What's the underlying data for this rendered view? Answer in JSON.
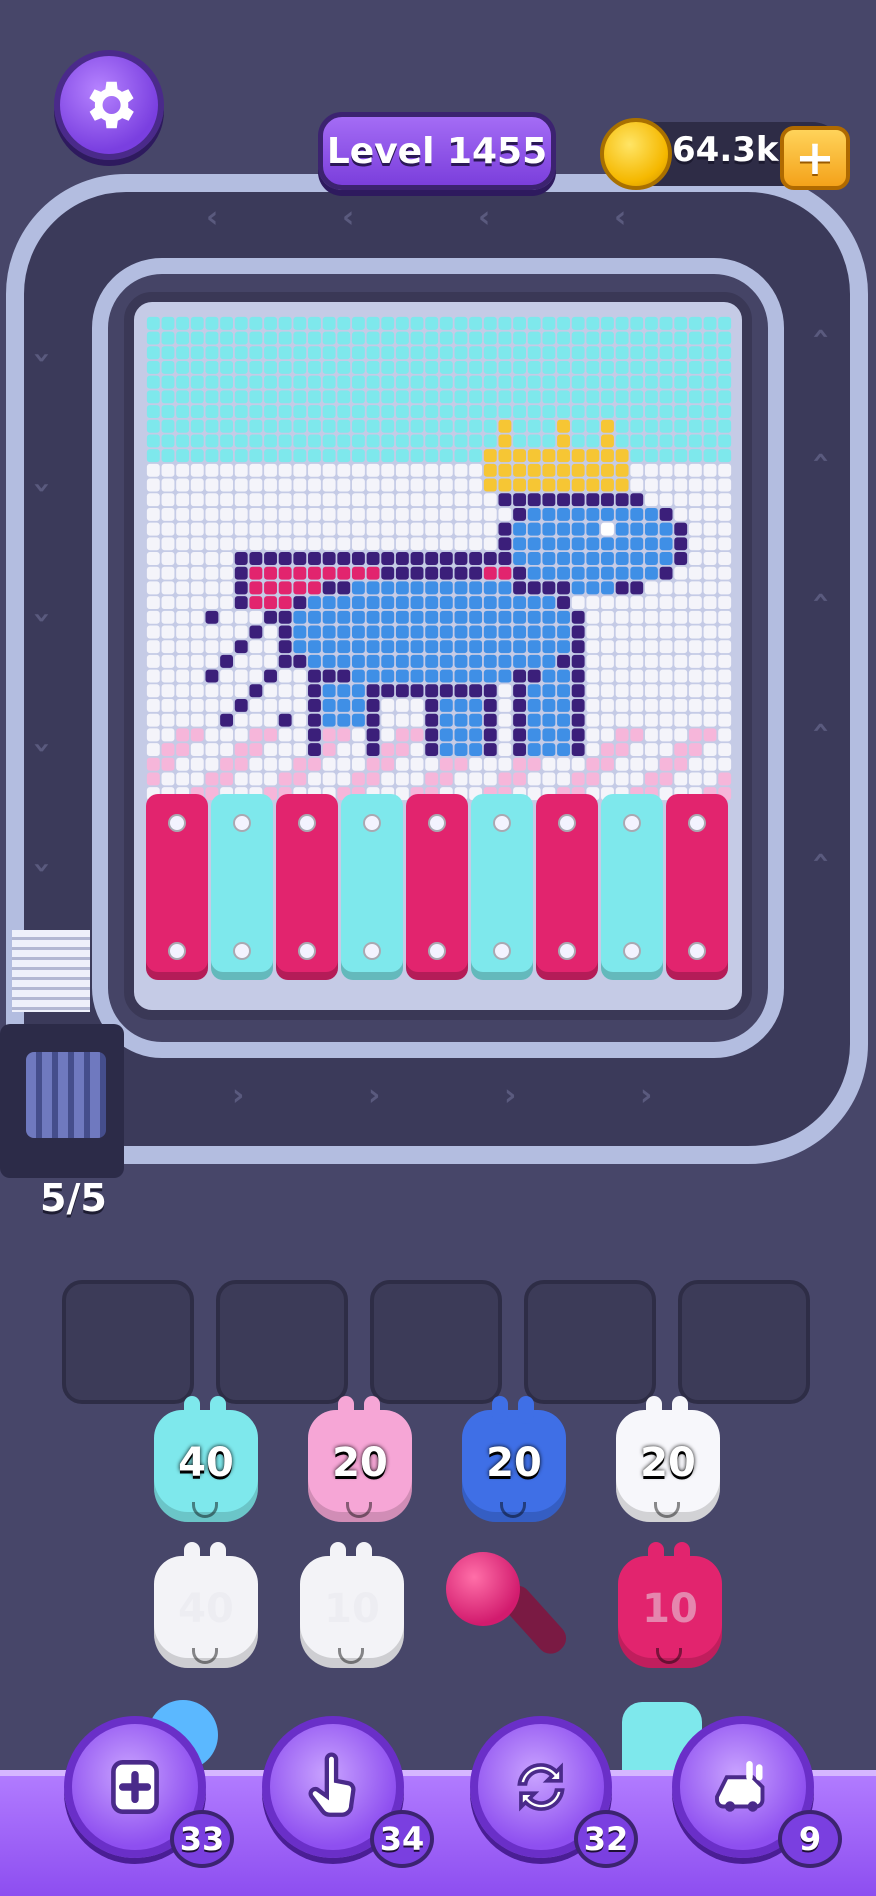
{
  "header": {
    "level_label": "Level 1455",
    "coins": "64.3k",
    "add_coins_symbol": "+"
  },
  "conveyor": {
    "counter": "5/5"
  },
  "slots": [
    "",
    "",
    "",
    "",
    ""
  ],
  "gate_colors": [
    "#e2246e",
    "#7ee8ec",
    "#e2246e",
    "#7ee8ec",
    "#e2246e",
    "#7ee8ec",
    "#e2246e",
    "#7ee8ec",
    "#e2246e"
  ],
  "units_row1": [
    {
      "value": "40",
      "color": "#7ee8ec"
    },
    {
      "value": "20",
      "color": "#f6a6d6"
    },
    {
      "value": "20",
      "color": "#3f6fe6"
    },
    {
      "value": "20",
      "color": "#f7f7fb"
    }
  ],
  "units_row2": [
    {
      "value": "40",
      "color": "#f3f3f7",
      "faded": true
    },
    {
      "value": "10",
      "color": "#f3f3f7",
      "faded": true
    },
    {
      "value": "10",
      "color": "#e2246e",
      "faded": true
    }
  ],
  "powerups": [
    {
      "name": "add-slot",
      "count": "33"
    },
    {
      "name": "hand-pick",
      "count": "34"
    },
    {
      "name": "shuffle",
      "count": "32"
    },
    {
      "name": "train",
      "count": "9"
    }
  ],
  "colors": {
    "sky": "#7ee8ec",
    "cloud": "#f4f4fa",
    "pink_ground": "#f6b6da",
    "outline": "#3b1f7a",
    "body": "#3f8fe6",
    "cape": "#e2246e",
    "crown": "#f6c634"
  }
}
